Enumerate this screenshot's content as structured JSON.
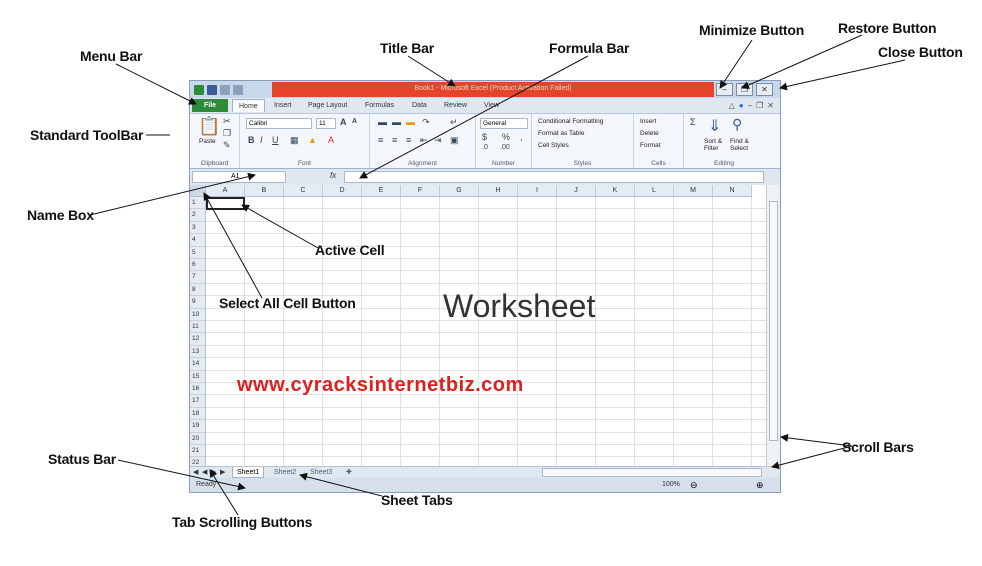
{
  "callouts": {
    "menu_bar": "Menu Bar",
    "title_bar": "Title Bar",
    "formula_bar": "Formula Bar",
    "minimize": "Minimize Button",
    "restore": "Restore Button",
    "close": "Close Button",
    "standard_toolbar": "Standard ToolBar",
    "name_box": "Name Box",
    "active_cell": "Active Cell",
    "select_all": "Select All Cell Button",
    "worksheet": "Worksheet",
    "scroll_bars": "Scroll Bars",
    "status_bar": "Status Bar",
    "sheet_tabs": "Sheet Tabs",
    "tab_scrolling": "Tab Scrolling Buttons"
  },
  "watermark": "www.cyracksinternetbiz.com",
  "excel": {
    "title": "Book1 - Microsoft Excel (Product Activation Failed)",
    "menu": {
      "file": "File",
      "items": [
        "Home",
        "Insert",
        "Page Layout",
        "Formulas",
        "Data",
        "Review",
        "View"
      ]
    },
    "ribbon": {
      "paste": "Paste",
      "font_name": "Calibri",
      "font_size": "11",
      "number_format": "General",
      "conditional_formatting": "Conditional Formatting",
      "format_as_table": "Format as Table",
      "cell_styles": "Cell Styles",
      "insert": "Insert",
      "delete": "Delete",
      "format": "Format",
      "sort_filter": "Sort & Filter",
      "find_select": "Find & Select",
      "groups": [
        "Clipboard",
        "Font",
        "Alignment",
        "Number",
        "Styles",
        "Cells",
        "Editing"
      ]
    },
    "name_box": "A1",
    "fx": "fx",
    "columns": [
      "A",
      "B",
      "C",
      "D",
      "E",
      "F",
      "G",
      "H",
      "I",
      "J",
      "K",
      "L",
      "M",
      "N"
    ],
    "rows": [
      "1",
      "2",
      "3",
      "4",
      "5",
      "6",
      "7",
      "8",
      "9",
      "10",
      "11",
      "12",
      "13",
      "14",
      "15",
      "16",
      "17",
      "18",
      "19",
      "20",
      "21",
      "22"
    ],
    "sheets": [
      "Sheet1",
      "Sheet2",
      "Sheet3"
    ],
    "status": "Ready",
    "zoom": "100%"
  }
}
